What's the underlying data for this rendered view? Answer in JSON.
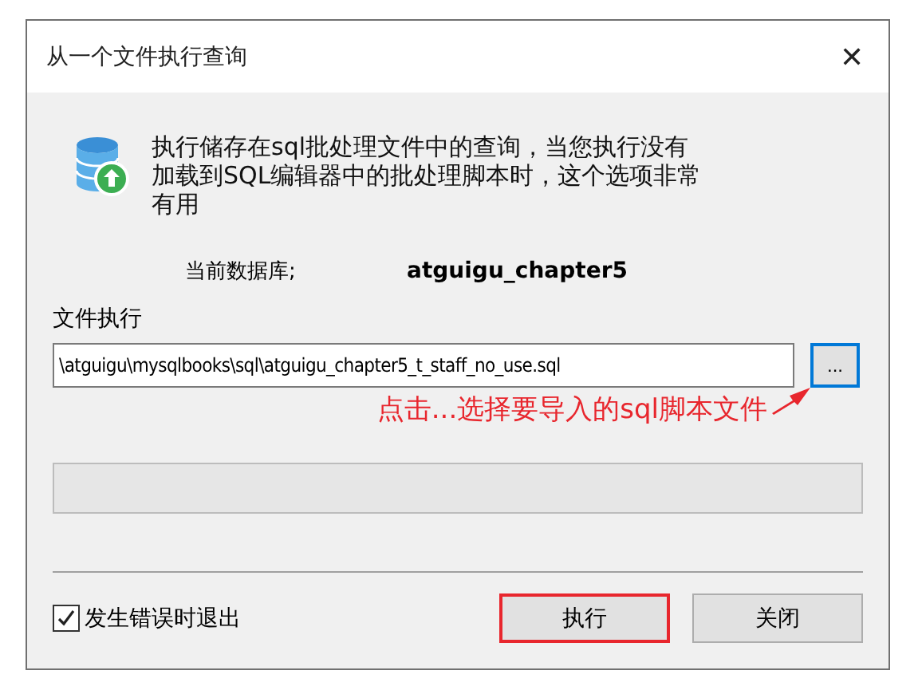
{
  "window": {
    "title": "从一个文件执行查询",
    "close": "✕"
  },
  "description": "执行储存在sql批处理文件中的查询，当您执行没有加载到SQL编辑器中的批处理脚本时，这个选项非常有用",
  "current_db": {
    "label": "当前数据库;",
    "value": "atguigu_chapter5"
  },
  "file": {
    "label": "文件执行",
    "value": "\\atguigu\\mysqlbooks\\sql\\atguigu_chapter5_t_staff_no_use.sql",
    "browse": "...",
    "browse_focused": true
  },
  "annotation": "点击...选择要导入的sql脚本文件",
  "progress": {
    "level": 0
  },
  "exit_on_error": {
    "label": "发生错误时退出",
    "checked": true
  },
  "buttons": [
    {
      "label": "执行",
      "highlighted": true
    },
    {
      "label": "关闭",
      "highlighted": false
    }
  ]
}
